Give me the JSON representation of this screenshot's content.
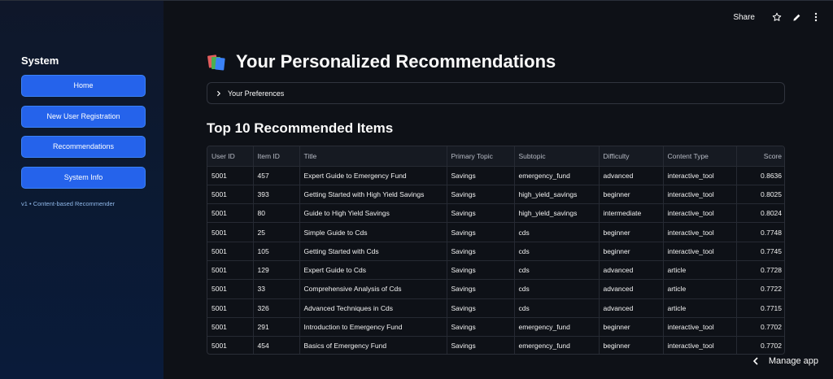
{
  "sidebar": {
    "title": "System",
    "nav": [
      "Home",
      "New User Registration",
      "Recommendations",
      "System Info"
    ],
    "caption": "v1 • Content-based Recommender"
  },
  "topbar": {
    "share": "Share",
    "icons": [
      "star-icon",
      "pencil-icon",
      "more-vert-icon"
    ]
  },
  "main": {
    "title": "Your Personalized Recommendations",
    "title_icon": "books-icon",
    "expander": "Your Preferences",
    "section_title": "Top 10 Recommended Items"
  },
  "table": {
    "columns": [
      "User ID",
      "Item ID",
      "Title",
      "Primary Topic",
      "Subtopic",
      "Difficulty",
      "Content Type",
      "Score"
    ],
    "rows": [
      [
        "5001",
        "457",
        "Expert Guide to Emergency Fund",
        "Savings",
        "emergency_fund",
        "advanced",
        "interactive_tool",
        "0.8636"
      ],
      [
        "5001",
        "393",
        "Getting Started with High Yield Savings",
        "Savings",
        "high_yield_savings",
        "beginner",
        "interactive_tool",
        "0.8025"
      ],
      [
        "5001",
        "80",
        "Guide to High Yield Savings",
        "Savings",
        "high_yield_savings",
        "intermediate",
        "interactive_tool",
        "0.8024"
      ],
      [
        "5001",
        "25",
        "Simple Guide to Cds",
        "Savings",
        "cds",
        "beginner",
        "interactive_tool",
        "0.7748"
      ],
      [
        "5001",
        "105",
        "Getting Started with Cds",
        "Savings",
        "cds",
        "beginner",
        "interactive_tool",
        "0.7745"
      ],
      [
        "5001",
        "129",
        "Expert Guide to Cds",
        "Savings",
        "cds",
        "advanced",
        "article",
        "0.7728"
      ],
      [
        "5001",
        "33",
        "Comprehensive Analysis of Cds",
        "Savings",
        "cds",
        "advanced",
        "article",
        "0.7722"
      ],
      [
        "5001",
        "326",
        "Advanced Techniques in Cds",
        "Savings",
        "cds",
        "advanced",
        "article",
        "0.7715"
      ],
      [
        "5001",
        "291",
        "Introduction to Emergency Fund",
        "Savings",
        "emergency_fund",
        "beginner",
        "interactive_tool",
        "0.7702"
      ],
      [
        "5001",
        "454",
        "Basics of Emergency Fund",
        "Savings",
        "emergency_fund",
        "beginner",
        "interactive_tool",
        "0.7702"
      ]
    ]
  },
  "footer": {
    "manage_app": "Manage app"
  },
  "colors": {
    "accent": "#2563eb",
    "background": "#0e1117"
  }
}
